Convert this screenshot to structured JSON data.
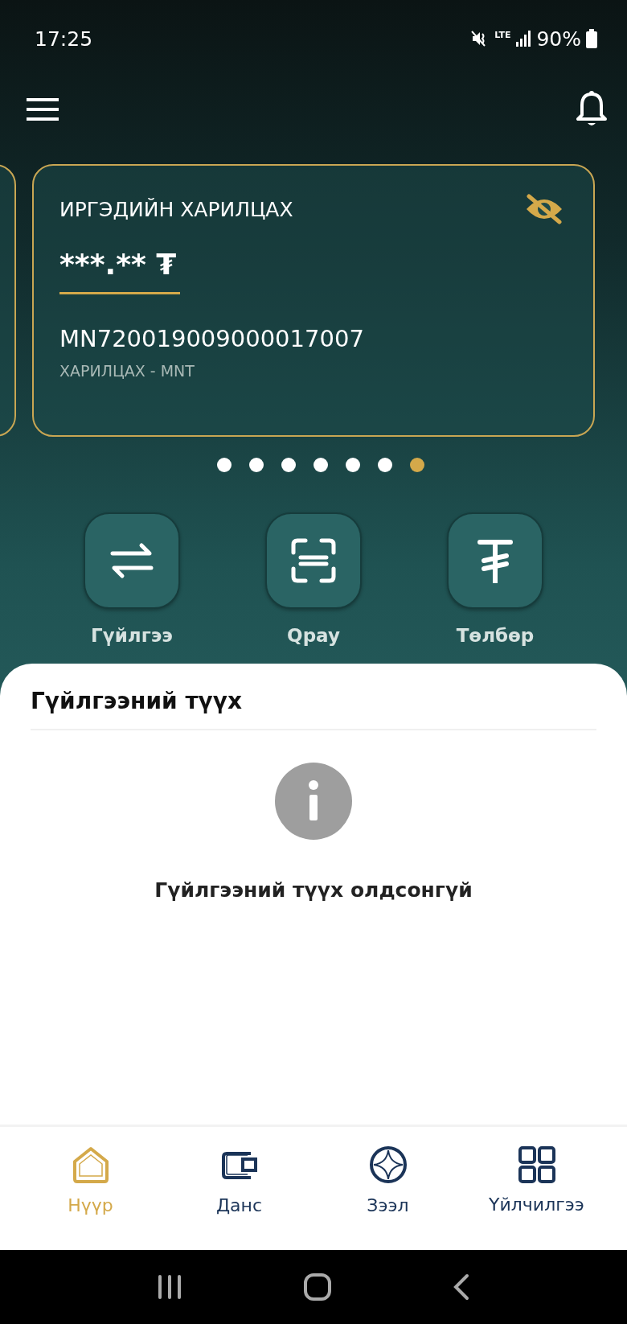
{
  "status_bar": {
    "time": "17:25",
    "network": "LTE",
    "battery": "90%"
  },
  "card": {
    "title": "ИРГЭДИЙН ХАРИЛЦАХ",
    "balance": "***.** ₮",
    "balance_hidden": true,
    "account_number": "MN720019009000017007",
    "account_type": "ХАРИЛЦАХ - MNT"
  },
  "pager": [
    {
      "selected": false
    },
    {
      "selected": false
    },
    {
      "selected": false
    },
    {
      "selected": false
    },
    {
      "selected": false
    },
    {
      "selected": false
    },
    {
      "selected": true
    }
  ],
  "actions": [
    {
      "kind": "transfer",
      "label": "Гүйлгээ"
    },
    {
      "kind": "scan",
      "label": "Qpay"
    },
    {
      "kind": "payment",
      "label": "Төлбөр"
    }
  ],
  "history": {
    "title": "Гүйлгээний түүх",
    "empty_message": "Гүйлгээний түүх олдсонгүй"
  },
  "nav": [
    {
      "kind": "home",
      "label": "Нүүр",
      "selected": true
    },
    {
      "kind": "wallet",
      "label": "Данс",
      "selected": false
    },
    {
      "kind": "loan",
      "label": "Зээл",
      "selected": false
    },
    {
      "kind": "services",
      "label": "Үйлчилгээ",
      "selected": false
    }
  ]
}
